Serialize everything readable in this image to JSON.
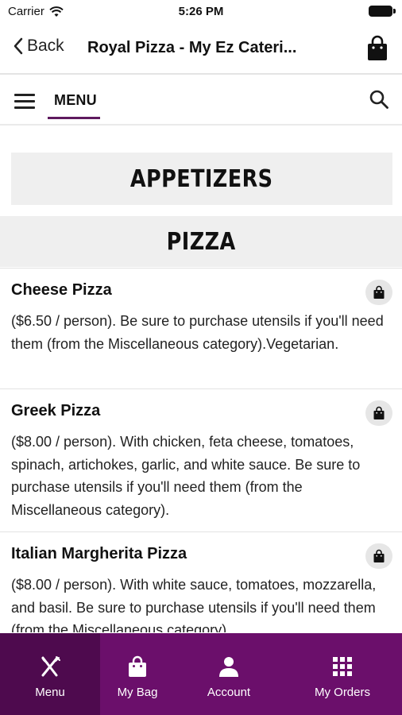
{
  "status_bar": {
    "carrier": "Carrier",
    "time": "5:26 PM"
  },
  "nav": {
    "back_label": "Back",
    "title": "Royal Pizza - My Ez Cateri..."
  },
  "menu_bar": {
    "tab_label": "MENU"
  },
  "categories": [
    {
      "title": "APPETIZERS"
    },
    {
      "title": "PIZZA"
    }
  ],
  "items": [
    {
      "name": "Cheese Pizza",
      "description": "($6.50 / person). Be sure to purchase utensils if you'll need them (from the Miscellaneous category).Vegetarian."
    },
    {
      "name": "Greek Pizza",
      "description": "($8.00 / person). With chicken, feta cheese, tomatoes, spinach, artichokes, garlic, and white sauce. Be sure to purchase utensils if you'll need them (from the Miscellaneous category)."
    },
    {
      "name": "Italian Margherita Pizza",
      "description": "($8.00 / person). With white sauce, tomatoes, mozzarella, and basil. Be sure to purchase utensils if you'll need them (from the Miscellaneous category)."
    }
  ],
  "tab_bar": {
    "tabs": [
      {
        "label": "Menu",
        "icon": "fork-knife-icon",
        "active": true
      },
      {
        "label": "My Bag",
        "icon": "shopping-bag-icon",
        "active": false
      },
      {
        "label": "Account",
        "icon": "person-icon",
        "active": false
      },
      {
        "label": "My Orders",
        "icon": "grid-icon",
        "active": false
      }
    ]
  },
  "colors": {
    "accent": "#6b0f6b",
    "accent_dark": "#4e0a4e",
    "category_bg": "#efefef"
  }
}
